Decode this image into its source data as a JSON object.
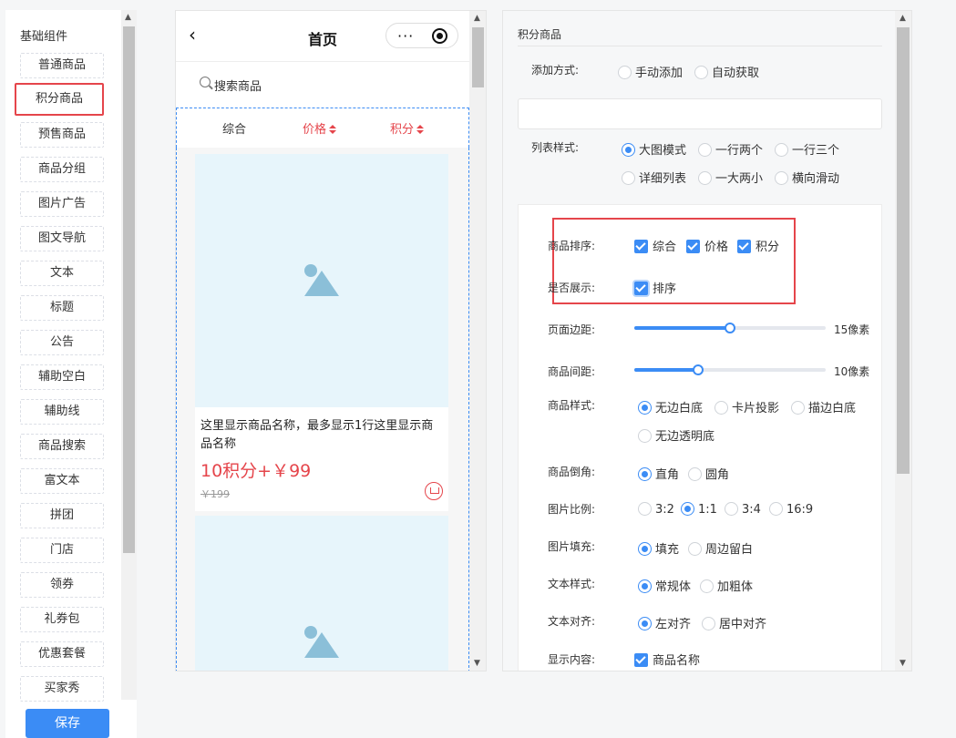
{
  "left_panel": {
    "title": "基础组件",
    "items": [
      "普通商品",
      "积分商品",
      "预售商品",
      "商品分组",
      "图片广告",
      "图文导航",
      "文本",
      "标题",
      "公告",
      "辅助空白",
      "辅助线",
      "商品搜索",
      "富文本",
      "拼团",
      "门店",
      "领券",
      "礼券包",
      "优惠套餐",
      "买家秀"
    ],
    "selected": "积分商品",
    "save_label": "保存"
  },
  "phone": {
    "back_icon": "chevron-left-icon",
    "title": "首页",
    "more_label": "···",
    "search_placeholder": "搜索商品",
    "sort_tabs": [
      "综合",
      "价格",
      "积分"
    ],
    "product": {
      "name": "这里显示商品名称，最多显示1行这里显示商品名称",
      "price": "10积分+￥99",
      "original_price": "￥199"
    }
  },
  "settings": {
    "title": "积分商品",
    "add_method": {
      "label": "添加方式:",
      "options": [
        "手动添加",
        "自动获取"
      ],
      "selected": null
    },
    "list_style": {
      "label": "列表样式:",
      "options": [
        "大图模式",
        "一行两个",
        "一行三个",
        "详细列表",
        "一大两小",
        "横向滑动"
      ],
      "selected": "大图模式"
    },
    "product_sort": {
      "label": "商品排序:",
      "options": [
        "综合",
        "价格",
        "积分"
      ],
      "checked": [
        "综合",
        "价格",
        "积分"
      ]
    },
    "show": {
      "label": "是否展示:",
      "option": "排序",
      "checked": true
    },
    "page_margin": {
      "label": "页面边距:",
      "value_text": "15像素",
      "fraction": 0.5
    },
    "item_spacing": {
      "label": "商品间距:",
      "value_text": "10像素",
      "fraction": 0.33
    },
    "product_style": {
      "label": "商品样式:",
      "options": [
        "无边白底",
        "卡片投影",
        "描边白底",
        "无边透明底"
      ],
      "selected": "无边白底"
    },
    "corner": {
      "label": "商品倒角:",
      "options": [
        "直角",
        "圆角"
      ],
      "selected": "直角"
    },
    "ratio": {
      "label": "图片比例:",
      "options": [
        "3:2",
        "1:1",
        "3:4",
        "16:9"
      ],
      "selected": "1:1"
    },
    "fill": {
      "label": "图片填充:",
      "options": [
        "填充",
        "周边留白"
      ],
      "selected": "填充"
    },
    "text_style": {
      "label": "文本样式:",
      "options": [
        "常规体",
        "加粗体"
      ],
      "selected": "常规体"
    },
    "text_align": {
      "label": "文本对齐:",
      "options": [
        "左对齐",
        "居中对齐"
      ],
      "selected": "左对齐"
    },
    "display_content": {
      "label": "显示内容:",
      "option": "商品名称",
      "checked": true
    }
  },
  "colors": {
    "accent": "#3b8cf5",
    "highlight": "#e5454b",
    "price": "#e5454b"
  }
}
